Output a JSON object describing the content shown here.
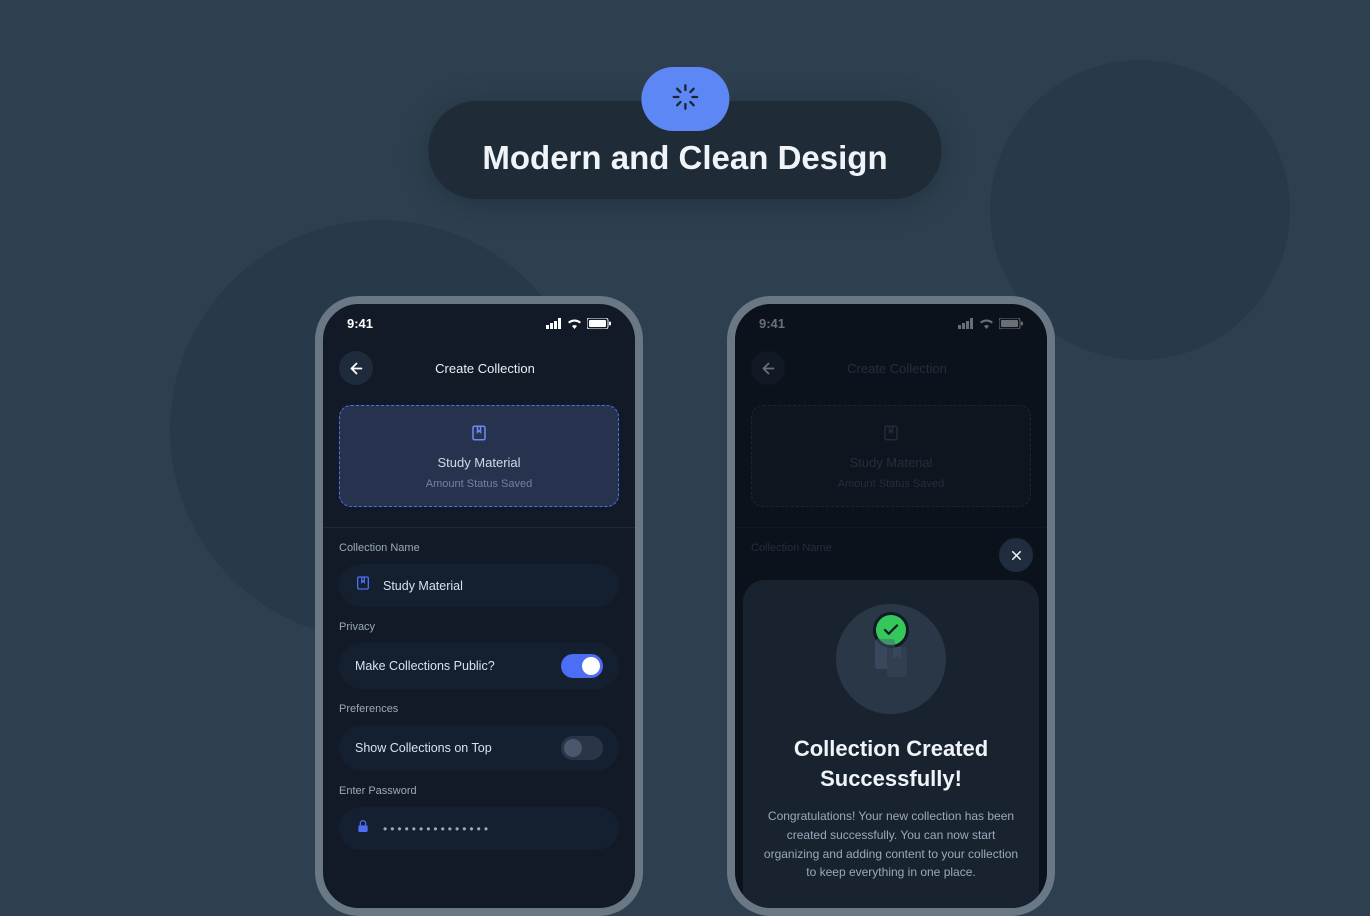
{
  "banner": {
    "title": "Modern and Clean Design"
  },
  "status": {
    "time": "9:41"
  },
  "phone1": {
    "header_title": "Create Collection",
    "preview": {
      "title": "Study Material",
      "subtitle": "Amount Status Saved"
    },
    "collection_name": {
      "label": "Collection Name",
      "value": "Study Material"
    },
    "privacy": {
      "label": "Privacy",
      "row": "Make Collections Public?",
      "toggle_on": true
    },
    "preferences": {
      "label": "Preferences",
      "row": "Show Collections on Top",
      "toggle_on": false
    },
    "password": {
      "label": "Enter Password",
      "value": "•••••••••••••••"
    }
  },
  "phone2": {
    "header_title": "Create Collection",
    "preview": {
      "title": "Study Material",
      "subtitle": "Amount Status Saved"
    },
    "collection_name_label": "Collection Name",
    "sheet": {
      "title": "Collection Created Successfully!",
      "body": "Congratulations! Your new collection has been created successfully. You can now start organizing and adding content to your collection to keep everything in one place."
    }
  }
}
